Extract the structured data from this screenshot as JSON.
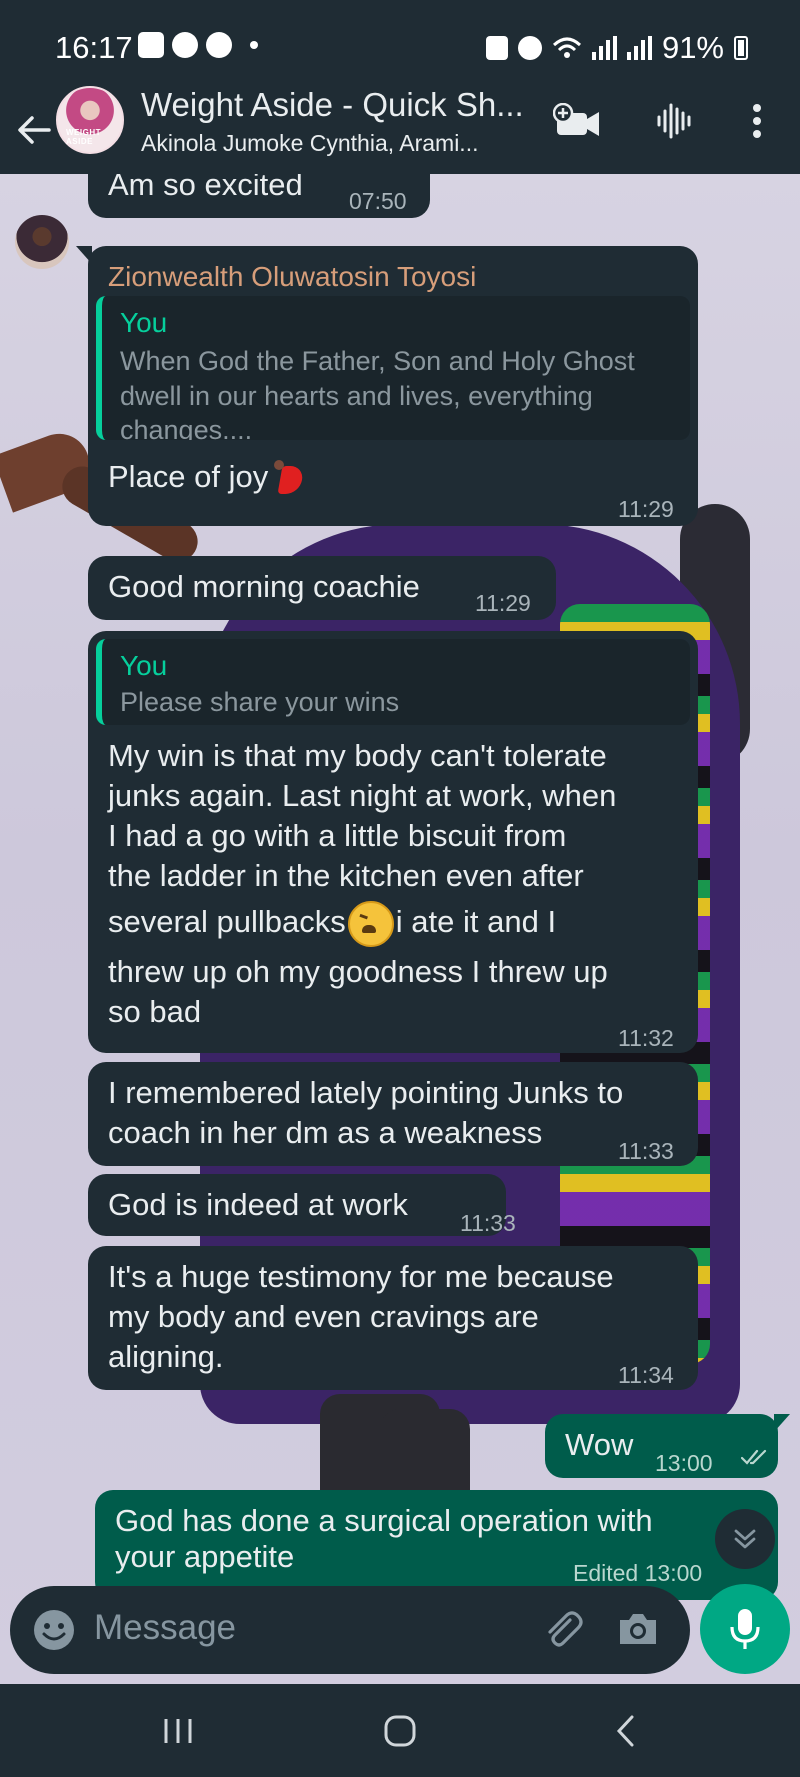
{
  "status_bar": {
    "time": "16:17",
    "battery": "91%"
  },
  "header": {
    "title": "Weight Aside - Quick Sh...",
    "subtitle": "Akinola Jumoke Cynthia, Arami...",
    "avatar_text": "WEIGHT ASIDE"
  },
  "messages": [
    {
      "id": "m1",
      "direction": "in",
      "text": "Am so excited",
      "time": "07:50"
    },
    {
      "id": "m2",
      "direction": "in",
      "sender": "Zionwealth Oluwatosin Toyosi",
      "quote_author": "You",
      "quote_lines": [
        "When God the Father, Son and Holy Ghost",
        "dwell in our hearts and lives, everything",
        "changes...."
      ],
      "text": "Place of joy",
      "emoji": "dancer",
      "time": "11:29"
    },
    {
      "id": "m3",
      "direction": "in",
      "text": "Good morning coachie",
      "time": "11:29"
    },
    {
      "id": "m4",
      "direction": "in",
      "quote_author": "You",
      "quote_lines": [
        "Please share your wins"
      ],
      "lines": [
        "My win is that my body can't tolerate",
        "junks again. Last night at work, when",
        "I had a go with a little biscuit from",
        "the ladder in the kitchen even after",
        "several pullbacks",
        "i ate it and I",
        "threw up oh my goodness I threw up",
        "so bad"
      ],
      "emoji": "weary",
      "time": "11:32"
    },
    {
      "id": "m5",
      "direction": "in",
      "lines": [
        "I remembered lately pointing Junks to",
        "coach in her dm  as a weakness"
      ],
      "time": "11:33"
    },
    {
      "id": "m6",
      "direction": "in",
      "text": "God is indeed at work",
      "time": "11:33"
    },
    {
      "id": "m7",
      "direction": "in",
      "lines": [
        "It's a huge testimony for me because",
        "my body and even cravings are",
        "aligning."
      ],
      "time": "11:34"
    },
    {
      "id": "m8",
      "direction": "out",
      "text": "Wow",
      "time": "13:00"
    },
    {
      "id": "m9",
      "direction": "out",
      "lines": [
        "God has done a surgical operation with",
        "your appetite"
      ],
      "meta": "Edited 13:00"
    }
  ],
  "input": {
    "placeholder": "Message"
  },
  "colors": {
    "header_bg": "#1f2c34",
    "incoming_bubble": "#1f2c34",
    "outgoing_bubble": "#005c4b",
    "accent": "#00a884",
    "sender_name": "#d79e7a",
    "quote_accent": "#06cf9c"
  },
  "icons": {
    "back": "arrow-left-icon",
    "video_call": "video-call-add-icon",
    "voice_call": "voice-waveform-icon",
    "menu": "more-vertical-icon",
    "emoji": "emoji-smile-icon",
    "attach": "paperclip-icon",
    "camera": "camera-icon",
    "mic": "microphone-icon",
    "scroll_down": "double-chevron-down-icon"
  }
}
